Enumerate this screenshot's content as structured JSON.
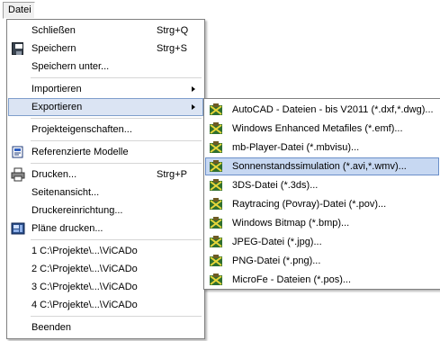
{
  "menubar": {
    "file_label": "Datei"
  },
  "main_menu": {
    "items": [
      {
        "label": "Schließen",
        "shortcut": "Strg+Q"
      },
      {
        "label": "Speichern",
        "shortcut": "Strg+S",
        "icon": "save-disk-icon"
      },
      {
        "label": "Speichern unter..."
      },
      {
        "label": "Importieren",
        "has_submenu": true
      },
      {
        "label": "Exportieren",
        "has_submenu": true
      },
      {
        "label": "Projekteigenschaften..."
      },
      {
        "label": "Referenzierte Modelle",
        "icon": "referenced-models-icon"
      },
      {
        "label": "Drucken...",
        "shortcut": "Strg+P",
        "icon": "printer-icon"
      },
      {
        "label": "Seitenansicht..."
      },
      {
        "label": "Druckereinrichtung..."
      },
      {
        "label": "Pläne drucken...",
        "icon": "plans-print-icon"
      },
      {
        "label": "1 C:\\Projekte\\...\\ViCADo"
      },
      {
        "label": "2 C:\\Projekte\\...\\ViCADo"
      },
      {
        "label": "3 C:\\Projekte\\...\\ViCADo"
      },
      {
        "label": "4 C:\\Projekte\\...\\ViCADo"
      },
      {
        "label": "Beenden"
      }
    ]
  },
  "export_submenu": {
    "items": [
      {
        "label": "AutoCAD - Dateien - bis V2011 (*.dxf,*.dwg)..."
      },
      {
        "label": "Windows Enhanced Metafiles (*.emf)..."
      },
      {
        "label": "mb-Player-Datei (*.mbvisu)..."
      },
      {
        "label": "Sonnenstandssimulation (*.avi,*.wmv)..."
      },
      {
        "label": "3DS-Datei (*.3ds)..."
      },
      {
        "label": "Raytracing (Povray)-Datei (*.pov)..."
      },
      {
        "label": "Windows Bitmap (*.bmp)..."
      },
      {
        "label": "JPEG-Datei (*.jpg)..."
      },
      {
        "label": "PNG-Datei (*.png)..."
      },
      {
        "label": "MicroFe - Dateien (*.pos)..."
      }
    ]
  },
  "colors": {
    "highlight": "#dbe4f3",
    "highlight_border": "#7f9ecb",
    "menu_border": "#808080"
  }
}
